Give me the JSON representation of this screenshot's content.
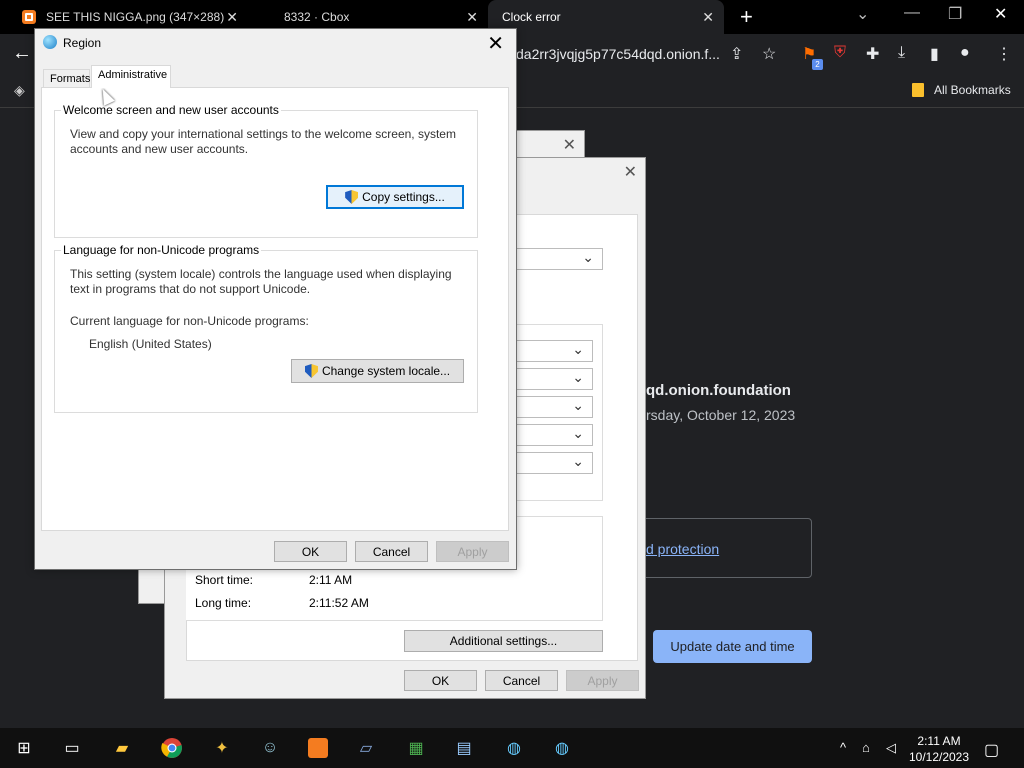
{
  "browser": {
    "tabs": [
      {
        "title": "SEE THIS NIGGA.png (347×288)",
        "close": "✕"
      },
      {
        "title": "8332 · Cbox",
        "close": "✕"
      },
      {
        "title": "Clock error",
        "close": "✕"
      }
    ],
    "new_tab": "+",
    "address": "da2rr3jvqjg5p77c54dqd.onion.f...",
    "bookmarks_label": "All Bookmarks",
    "extension_badge": "2"
  },
  "page": {
    "site": "qd.onion.foundation",
    "date": "rsday, October 12, 2023",
    "link": "d protection",
    "update_button": "Update date and time"
  },
  "background_dialog": {
    "short_time_label": "Short time:",
    "short_time_value": "2:11 AM",
    "long_time_label": "Long time:",
    "long_time_value": "2:11:52 AM",
    "additional_settings": "Additional settings...",
    "ok": "OK",
    "cancel": "Cancel",
    "apply": "Apply"
  },
  "region_dialog": {
    "title": "Region",
    "tabs": [
      "Formats",
      "Administrative"
    ],
    "welcome_group": {
      "label": "Welcome screen and new user accounts",
      "description": "View and copy your international settings to the welcome screen, system accounts and new user accounts.",
      "button": "Copy settings..."
    },
    "unicode_group": {
      "label": "Language for non-Unicode programs",
      "description": "This setting (system locale) controls the language used when displaying text in programs that do not support Unicode.",
      "current_label": "Current language for non-Unicode programs:",
      "current_value": "English (United States)",
      "button": "Change system locale..."
    },
    "ok": "OK",
    "cancel": "Cancel",
    "apply": "Apply"
  },
  "taskbar": {
    "time": "2:11 AM",
    "date": "10/12/2023"
  },
  "colors": {
    "accent": "#0078d7",
    "page_button": "#8ab4f8",
    "chrome_bg": "#202124"
  }
}
